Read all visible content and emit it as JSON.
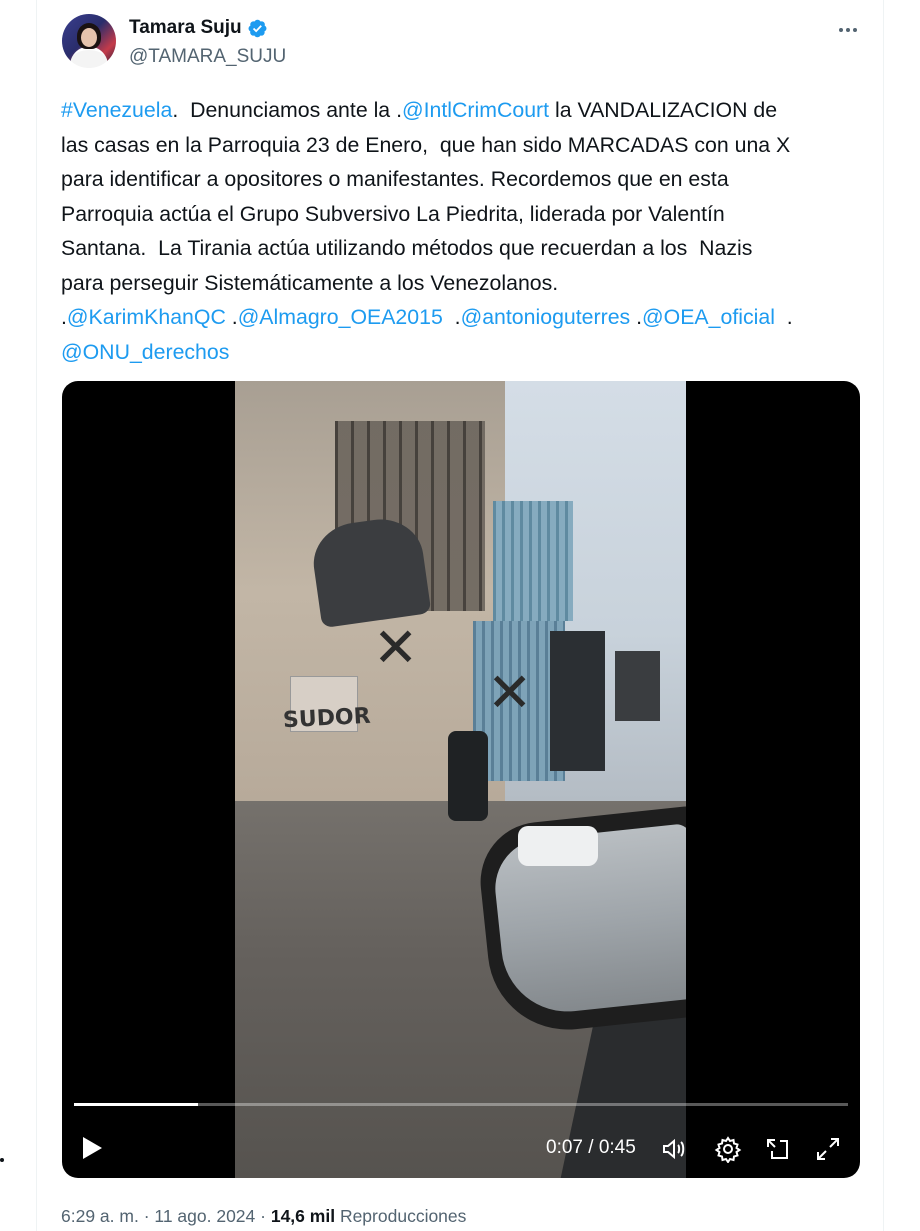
{
  "author": {
    "display_name": "Tamara Suju",
    "handle": "@TAMARA_SUJU",
    "verified": true,
    "verified_color": "#1d9bf0"
  },
  "more_icon": "more-horizontal-icon",
  "tweet": {
    "lines": [
      [
        {
          "t": "#Venezuela",
          "link": true
        },
        {
          "t": ".  Denunciamos ante la ."
        },
        {
          "t": "@IntlCrimCourt",
          "link": true
        },
        {
          "t": " la VANDALIZACION de"
        }
      ],
      [
        {
          "t": "las casas en la Parroquia 23 de Enero,  que han sido MARCADAS con una X"
        }
      ],
      [
        {
          "t": "para identificar a opositores o manifestantes. Recordemos que en esta"
        }
      ],
      [
        {
          "t": "Parroquia actúa el Grupo Subversivo La Piedrita, liderada por Valentín"
        }
      ],
      [
        {
          "t": "Santana.  La Tirania actúa utilizando métodos que recuerdan a los  Nazis"
        }
      ],
      [
        {
          "t": "para perseguir Sistemáticamente a los Venezolanos."
        }
      ],
      [
        {
          "t": "."
        },
        {
          "t": "@KarimKhanQC",
          "link": true
        },
        {
          "t": " ."
        },
        {
          "t": "@Almagro_OEA2015",
          "link": true
        },
        {
          "t": "  ."
        },
        {
          "t": "@antonioguterres",
          "link": true
        },
        {
          "t": " ."
        },
        {
          "t": "@OEA_oficial",
          "link": true
        },
        {
          "t": "  ."
        }
      ],
      [
        {
          "t": "@ONU_derechos",
          "link": true
        }
      ]
    ],
    "link_color": "#1d9bf0"
  },
  "video": {
    "time_display": "0:07 / 0:45",
    "current": "0:07",
    "duration": "0:45",
    "progress": 0.16,
    "sign_text": "SUDOR",
    "controls": [
      "play-icon",
      "volume-icon",
      "settings-icon",
      "pip-icon",
      "fullscreen-icon"
    ]
  },
  "meta": {
    "time": "6:29 a. m.",
    "separator": " · ",
    "date": "11 ago. 2024",
    "views_count": "14,6 mil",
    "views_label": "Reproducciones"
  }
}
